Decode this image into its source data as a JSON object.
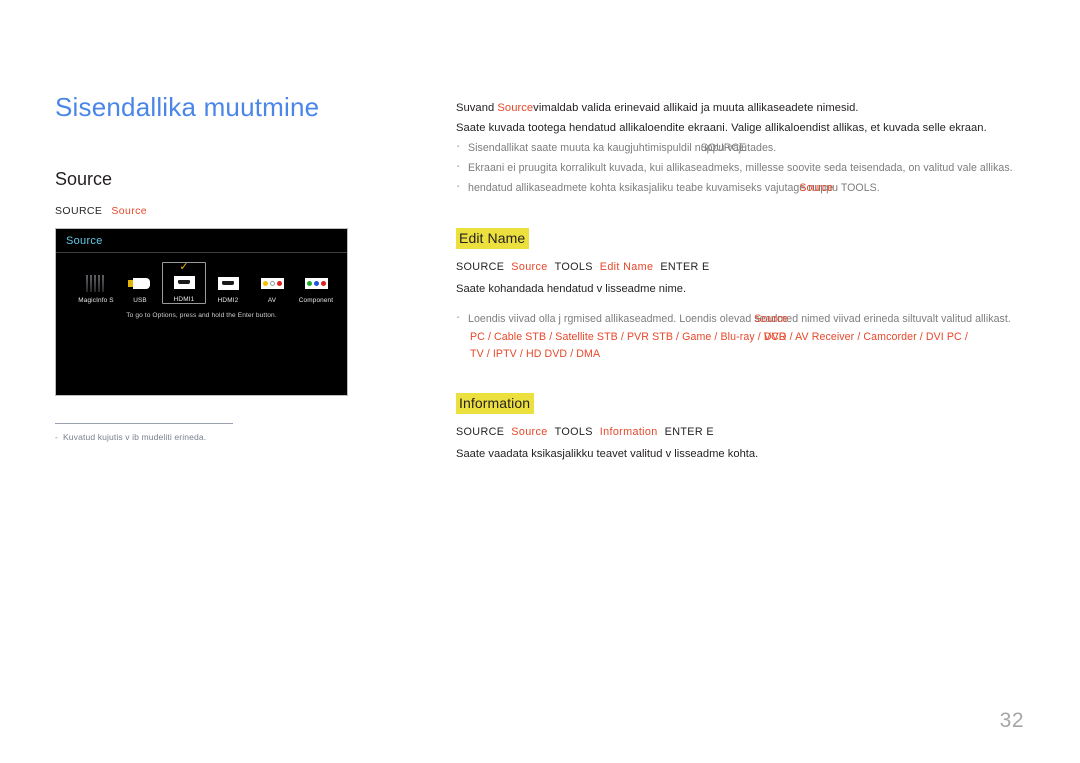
{
  "page": {
    "title": "Sisendallika muutmine",
    "number": "32",
    "accent_color": "#e8472a",
    "title_color": "#4a86e8",
    "highlight_color": "#ece03f"
  },
  "left": {
    "section_title": "Source",
    "breadcrumb": {
      "root": "SOURCE",
      "item": "Source"
    },
    "tv": {
      "header_label": "Source",
      "hint": "To go to Options, press and hold the Enter button.",
      "sources": [
        {
          "label": "MagicInfo S",
          "icon": "magicinfo-icon",
          "selected": false
        },
        {
          "label": "USB",
          "icon": "usb-icon",
          "selected": false
        },
        {
          "label": "HDMI1",
          "icon": "hdmi-icon",
          "selected": true
        },
        {
          "label": "HDMI2",
          "icon": "hdmi-icon",
          "selected": false
        },
        {
          "label": "AV",
          "icon": "av-rca-icon",
          "selected": false
        },
        {
          "label": "Component",
          "icon": "component-rca-icon",
          "selected": false
        }
      ]
    },
    "footnote": {
      "dash": "-",
      "text": "Kuvatud kujutis v ib mudeliti erineda."
    }
  },
  "right": {
    "intro": {
      "p1_before": "Suvand ",
      "p1_accent": "Source",
      "p1_after": "v",
      "p1_tail": "imaldab valida erinevaid allikaid ja muuta allikaseadete nimesid.",
      "p2": "Saate kuvada tootega  hendatud allikaloendite ekraani. Valige allikaloendist allikas, et kuvada selle ekraan."
    },
    "bullets": [
      {
        "before": "Sisendallikat saate muuta ka kaugjuhtimispuldil n",
        "overlap_a": "uppu",
        "overlap_b": "SOURCE",
        "after": " vajutades."
      },
      {
        "text": "Ekraani ei pruugita korralikult kuvada, kui allikaseadmeks, millesse soovite seda teisendada, on valitud vale allikas."
      },
      {
        "before": " hendatud allikaseadmete kohta  ksikasjaliku teabe kuvamiseks vajutag",
        "overlap_a": "e",
        "overlap_b": "Source",
        "after": " nuppu TOOLS."
      }
    ],
    "edit_name": {
      "heading": "Edit Name",
      "cmd": [
        "SOURCE",
        "Source",
        "TOOLS",
        "Edit Name",
        "ENTER E"
      ],
      "cmd_accent_index": [
        1,
        3
      ],
      "description": "Saate kohandada  hendatud v lisseadme nime.",
      "note_before": "Loendis viivad olla j rgmised allikaseadmed. Loendis olevad ",
      "note_overlap_a": "seadmed",
      "note_overlap_b": "Source",
      "note_after": " nimed viivad erineda siltuvalt valitud allikast.",
      "devices_line1_before": "PC / Cable STB / Satellite STB / PVR STB / Game / Blu-ray / ",
      "devices_overlap_a": "DVD",
      "devices_overlap_b": "VCR",
      "devices_line1_after": " / AV Receiver / Camcorder / DVI PC /",
      "devices_line2": "TV / IPTV / HD DVD / DMA"
    },
    "information": {
      "heading": "Information",
      "cmd": [
        "SOURCE",
        "Source",
        "TOOLS",
        "Information",
        "ENTER E"
      ],
      "cmd_accent_index": [
        1,
        3
      ],
      "description": "Saate vaadata  ksikasjalikku teavet valitud v lisseadme kohta."
    }
  }
}
